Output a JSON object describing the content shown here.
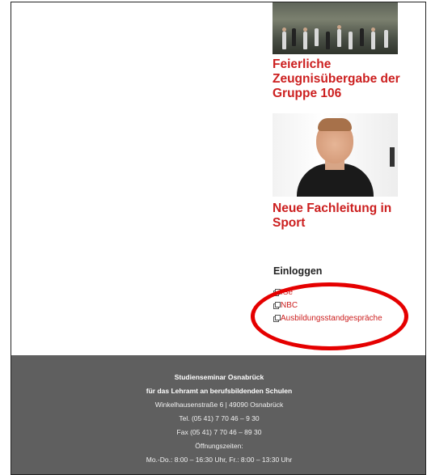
{
  "news": [
    {
      "title": "Feierliche Zeugnisübergabe der Gruppe 106",
      "image": "group-photo"
    },
    {
      "title": "Neue Fachleitung in Sport",
      "image": "portrait-photo"
    }
  ],
  "login": {
    "heading": "Einloggen",
    "links": [
      "ISe",
      "NBC",
      "Ausbildungsstandgespräche"
    ],
    "icon": "external-link-icon"
  },
  "annotation": {
    "color": "#e50000",
    "shape": "ellipse"
  },
  "footer": {
    "name": "Studienseminar Osnabrück",
    "subtitle": "für das Lehramt an berufsbildenden Schulen",
    "address": "Winkelhausenstraße 6 | 49090 Osnabrück",
    "tel": "Tel. (05 41) 7 70 46 – 9 30",
    "fax": "Fax (05 41) 7 70 46 – 89 30",
    "hours_label": "Öffnungszeiten:",
    "hours": "Mo.-Do.: 8:00 – 16:30 Uhr, Fr.: 8:00 – 13:30 Uhr"
  },
  "colors": {
    "accent": "#cc1f1f",
    "footer_bg": "#5f5f5f"
  }
}
